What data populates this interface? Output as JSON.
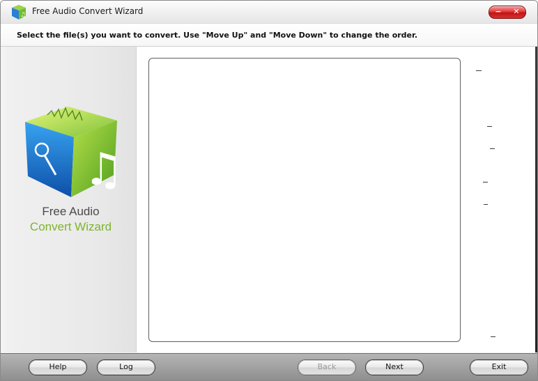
{
  "window": {
    "title": "Free Audio Convert Wizard",
    "minimize_label": "−",
    "close_label": "✕"
  },
  "instruction": "Select the file(s) you want to convert. Use \"Move Up\" and \"Move Down\" to change the order.",
  "logo": {
    "line1": "Free Audio",
    "line2": "Convert Wizard"
  },
  "file_list": {
    "items": []
  },
  "footer": {
    "help": "Help",
    "log": "Log",
    "back": "Back",
    "next": "Next",
    "exit": "Exit"
  },
  "colors": {
    "logo_green": "#7cb52a",
    "close_red": "#d83030"
  }
}
